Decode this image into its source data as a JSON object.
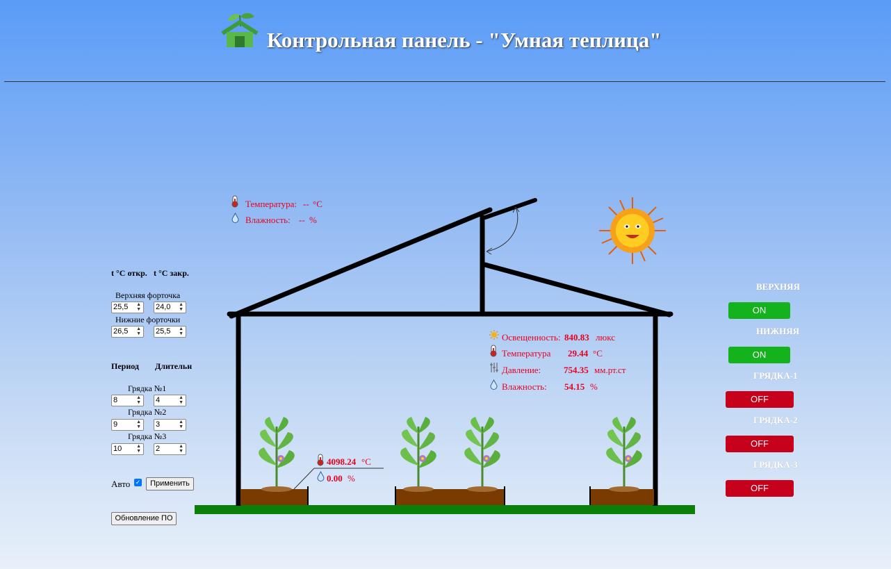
{
  "header": {
    "title": "Контрольная панель - \"Умная теплица\""
  },
  "outside": {
    "temp_label": "Температура:",
    "temp_value": "--",
    "temp_unit": "°C",
    "hum_label": "Влажность:",
    "hum_value": "--",
    "hum_unit": "%"
  },
  "inside": {
    "light_label": "Освещенность:",
    "light_value": "840.83",
    "light_unit": "люкс",
    "temp_label": "Температура",
    "temp_value": "29.44",
    "temp_unit": "°C",
    "press_label": "Давление:",
    "press_value": "754.35",
    "press_unit": "мм.рт.ст",
    "hum_label": "Влажность:",
    "hum_value": "54.15",
    "hum_unit": "%"
  },
  "soil": {
    "temp_value": "4098.24",
    "temp_unit": "°C",
    "hum_value": "0.00",
    "hum_unit": "%"
  },
  "settings": {
    "col_open": "t °C откр.",
    "col_close": "t °C закр.",
    "upper_label": "Верхняя форточка",
    "upper_open": "25,5",
    "upper_close": "24,0",
    "lower_label": "Нижние форточки",
    "lower_open": "26,5",
    "lower_close": "25,5",
    "col_period": "Период",
    "col_duration": "Длительн",
    "bed1_label": "Грядка №1",
    "bed1_period": "8",
    "bed1_duration": "4",
    "bed2_label": "Грядка №2",
    "bed2_period": "9",
    "bed2_duration": "3",
    "bed3_label": "Грядка №3",
    "bed3_period": "10",
    "bed3_duration": "2",
    "auto_label": "Авто",
    "auto_checked": true,
    "apply_label": "Применить",
    "update_label": "Обновление ПО"
  },
  "toggles": [
    {
      "label": "ВЕРХНЯЯ",
      "state": "ON"
    },
    {
      "label": "НИЖНЯЯ",
      "state": "ON"
    },
    {
      "label": "ГРЯДКА-1",
      "state": "OFF"
    },
    {
      "label": "ГРЯДКА-2",
      "state": "OFF"
    },
    {
      "label": "ГРЯДКА-3",
      "state": "OFF"
    }
  ],
  "colors": {
    "on": "#14b31e",
    "off": "#c7001c",
    "readings": "#e8001f",
    "ground": "#0a7f0a",
    "soil_bed": "#7a3b00"
  },
  "icons": [
    "logo-house-icon",
    "thermometer-icon",
    "droplet-icon",
    "sun-icon",
    "barometer-icon",
    "plant-icon"
  ]
}
